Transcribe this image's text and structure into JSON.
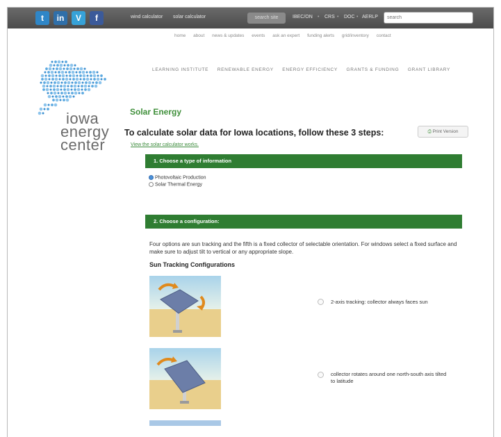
{
  "topbar": {
    "social": [
      {
        "icon": "twitter-icon",
        "glyph": "t",
        "color": "#2f86c7"
      },
      {
        "icon": "linkedin-icon",
        "glyph": "in",
        "color": "#2f6fa9"
      },
      {
        "icon": "vimeo-icon",
        "glyph": "V",
        "color": "#37a2d8"
      },
      {
        "icon": "facebook-icon",
        "glyph": "f",
        "color": "#3b5a9a"
      }
    ],
    "wind_calculator": "wind calculator",
    "solar_calculator": "solar calculator",
    "search_button": "search site",
    "links": [
      "IBEC/ON",
      "CRS",
      "DOC",
      "AERLP"
    ],
    "search_placeholder": "search"
  },
  "utility_links": [
    "home",
    "about",
    "news & updates",
    "events",
    "ask an expert",
    "funding alerts",
    "grid/inventory",
    "contact"
  ],
  "logo": {
    "line1": "iowa",
    "line2": "energy",
    "line3": "center"
  },
  "main_nav": [
    "LEARNING INSTITUTE",
    "RENEWABLE ENERGY",
    "ENERGY EFFICIENCY",
    "GRANTS & FUNDING",
    "GRANT LIBRARY"
  ],
  "content": {
    "title": "Solar Energy",
    "intro": "To calculate solar data for Iowa locations, follow these 3 steps:",
    "how_link": "View the solar calculator works.",
    "print_button": "Print Version",
    "step1": {
      "label": "1. Choose a type of information",
      "options": [
        {
          "label": "Photovoltaic Production",
          "selected": true
        },
        {
          "label": "Solar Thermal Energy",
          "selected": false
        }
      ]
    },
    "step2": {
      "label": "2. Choose a configuration:",
      "description": "Four options are sun tracking and the fifth is a fixed collector of selectable orientation. For windows select a fixed surface and make sure to adjust tilt to vertical or any appropriate slope.",
      "sun_heading": "Sun Tracking Configurations",
      "configs": [
        {
          "label": "2-axis tracking: collector always faces sun",
          "icon": "two-axis-tracker-illustration"
        },
        {
          "label": "collector rotates around one north-south axis tilted to latitude",
          "icon": "one-axis-tracker-illustration"
        }
      ]
    }
  },
  "colors": {
    "accent_green": "#2f7d32",
    "title_green": "#3f8f3a",
    "topbar": "#555555"
  }
}
